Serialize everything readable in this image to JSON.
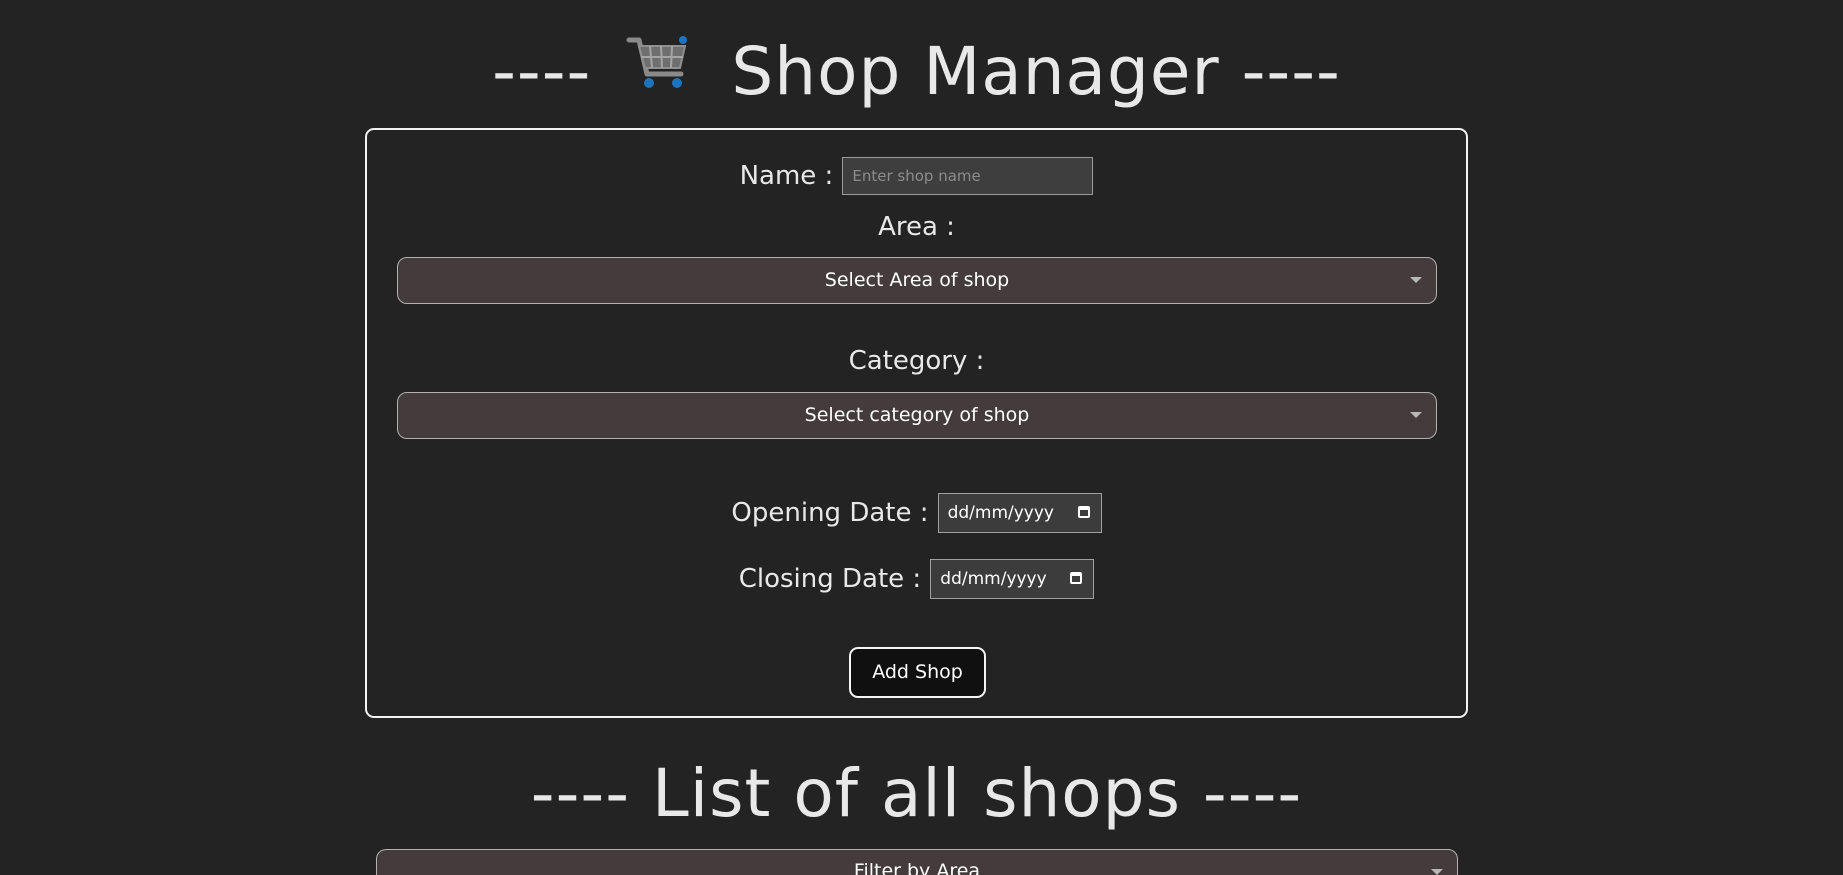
{
  "header": {
    "title_prefix": "----",
    "title_main": "Shop Manager ----",
    "cart_icon": "shopping-cart-icon"
  },
  "form": {
    "name_label": "Name :",
    "name_placeholder": "Enter shop name",
    "area_label": "Area :",
    "area_select": "Select Area of shop",
    "category_label": "Category :",
    "category_select": "Select category of shop",
    "opening_label": "Opening Date :",
    "opening_value": "dd/mm/yyyy",
    "closing_label": "Closing Date :",
    "closing_value": "dd/mm/yyyy",
    "submit_label": "Add Shop"
  },
  "list": {
    "title": "---- List of all shops ----",
    "filter_select": "Filter by Area"
  },
  "colors": {
    "background": "#232323",
    "select_bg": "#443c3c",
    "cart_accent": "#1e73be"
  }
}
